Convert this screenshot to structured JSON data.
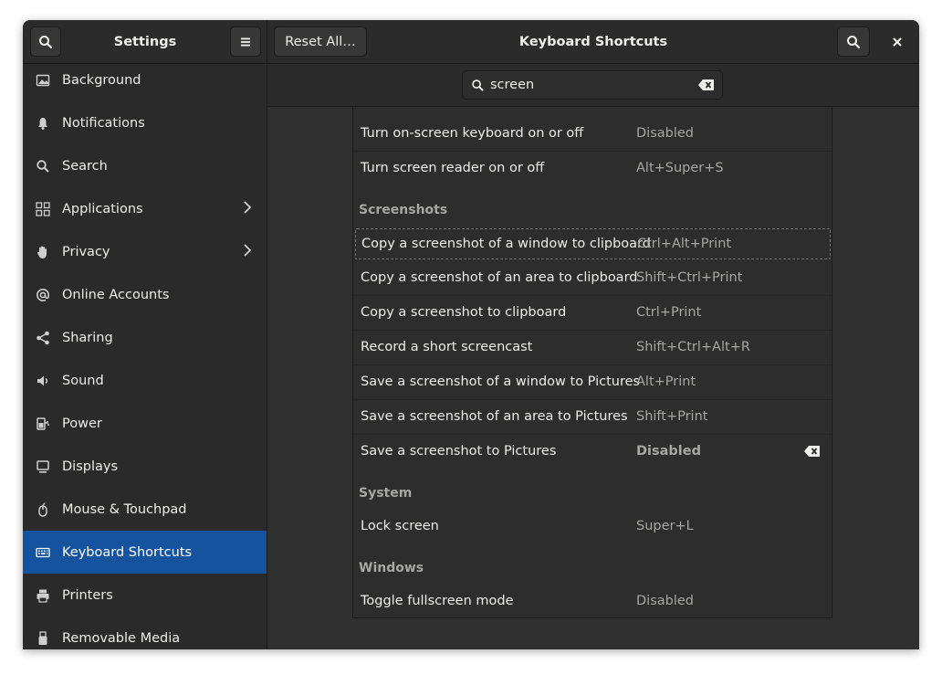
{
  "sidebar_title": "Settings",
  "reset_label": "Reset All…",
  "page_title": "Keyboard Shortcuts",
  "search": {
    "value": "screen"
  },
  "sidebar": {
    "items": [
      {
        "label": "Background",
        "icon": "image-icon"
      },
      {
        "label": "Notifications",
        "icon": "bell-icon"
      },
      {
        "label": "Search",
        "icon": "search-icon"
      },
      {
        "label": "Applications",
        "icon": "grid-icon",
        "has_submenu": true
      },
      {
        "label": "Privacy",
        "icon": "hand-icon",
        "has_submenu": true
      },
      {
        "label": "Online Accounts",
        "icon": "at-icon"
      },
      {
        "label": "Sharing",
        "icon": "share-icon"
      },
      {
        "label": "Sound",
        "icon": "speaker-icon"
      },
      {
        "label": "Power",
        "icon": "power-plug-icon"
      },
      {
        "label": "Displays",
        "icon": "monitor-icon"
      },
      {
        "label": "Mouse & Touchpad",
        "icon": "mouse-icon"
      },
      {
        "label": "Keyboard Shortcuts",
        "icon": "keyboard-icon",
        "selected": true
      },
      {
        "label": "Printers",
        "icon": "printer-icon"
      },
      {
        "label": "Removable Media",
        "icon": "usb-icon"
      }
    ]
  },
  "shortcuts": {
    "top_rows": [
      {
        "label": "Turn on-screen keyboard on or off",
        "accel": "Disabled"
      },
      {
        "label": "Turn screen reader on or off",
        "accel": "Alt+Super+S"
      }
    ],
    "screenshots_header": "Screenshots",
    "screenshots": [
      {
        "label": "Copy a screenshot of a window to clipboard",
        "accel": "Ctrl+Alt+Print"
      },
      {
        "label": "Copy a screenshot of an area to clipboard",
        "accel": "Shift+Ctrl+Print"
      },
      {
        "label": "Copy a screenshot to clipboard",
        "accel": "Ctrl+Print"
      },
      {
        "label": "Record a short screencast",
        "accel": "Shift+Ctrl+Alt+R"
      },
      {
        "label": "Save a screenshot of a window to Pictures",
        "accel": "Alt+Print"
      },
      {
        "label": "Save a screenshot of an area to Pictures",
        "accel": "Shift+Print"
      },
      {
        "label": "Save a screenshot to Pictures",
        "accel": "Disabled"
      }
    ],
    "system_header": "System",
    "system": [
      {
        "label": "Lock screen",
        "accel": "Super+L"
      }
    ],
    "windows_header": "Windows",
    "windows": [
      {
        "label": "Toggle fullscreen mode",
        "accel": "Disabled"
      }
    ]
  },
  "colors": {
    "accent": "#15539e",
    "window_bg": "#303030",
    "text": "#eeeeec",
    "dim_text": "#a6a6a4"
  }
}
